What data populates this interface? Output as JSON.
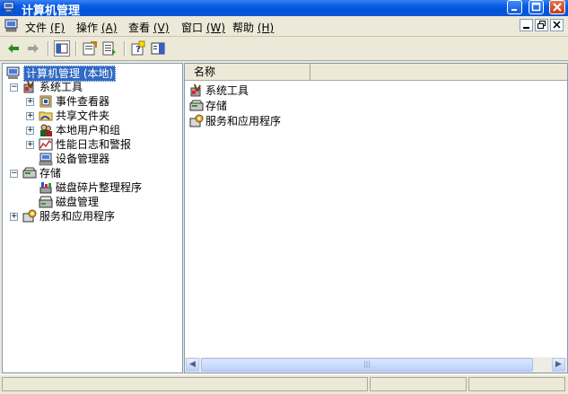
{
  "window": {
    "title": "计算机管理"
  },
  "menu": {
    "items": [
      {
        "label": "文件",
        "key": "(F)"
      },
      {
        "label": "操作",
        "key": "(A)"
      },
      {
        "label": "查看",
        "key": "(V)"
      },
      {
        "label": "窗口",
        "key": "(W)"
      },
      {
        "label": "帮助",
        "key": "(H)"
      }
    ]
  },
  "toolbar": {
    "icons": [
      "back-icon",
      "forward-icon",
      "show-hide-tree-icon",
      "properties-icon",
      "export-list-icon",
      "help-icon",
      "show-hide-action-pane-icon"
    ]
  },
  "tree": {
    "root": "计算机管理 (本地)",
    "system_tools": "系统工具",
    "event_viewer": "事件查看器",
    "shared_folders": "共享文件夹",
    "local_users": "本地用户和组",
    "perf_logs": "性能日志和警报",
    "device_manager": "设备管理器",
    "storage": "存储",
    "defrag": "磁盘碎片整理程序",
    "disk_mgmt": "磁盘管理",
    "services_apps": "服务和应用程序"
  },
  "list": {
    "column_name": "名称",
    "items": [
      "系统工具",
      "存储",
      "服务和应用程序"
    ]
  },
  "colors": {
    "selection": "#316ac5",
    "titlebar": "#0a5ce6",
    "face": "#ece9d8"
  }
}
